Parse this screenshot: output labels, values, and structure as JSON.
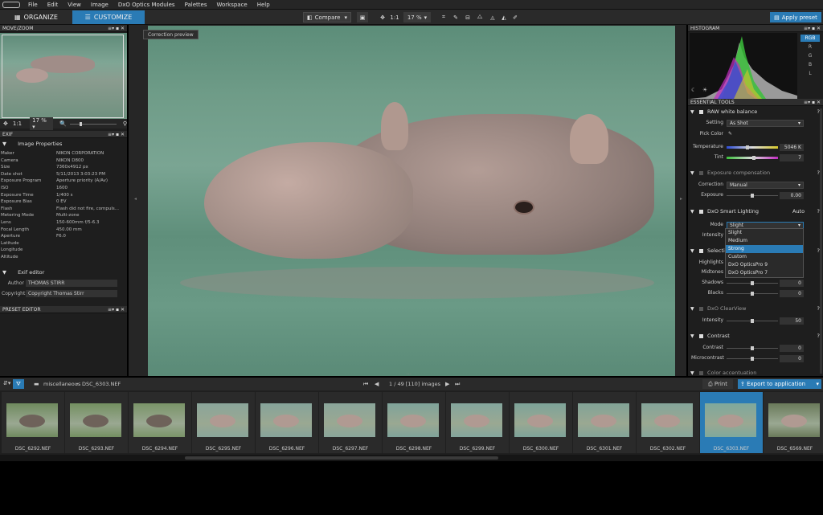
{
  "menu": [
    "File",
    "Edit",
    "View",
    "Image",
    "DxO Optics Modules",
    "Palettes",
    "Workspace",
    "Help"
  ],
  "toolbar": {
    "organize": "ORGANIZE",
    "customize": "CUSTOMIZE",
    "compare": "Compare",
    "zoom_ratio": "1:1",
    "zoom_pct": "17 %",
    "apply_preset": "Apply preset"
  },
  "left": {
    "movezoom_title": "MOVE/ZOOM",
    "zoom_ratio": "1:1",
    "zoom_pct": "17 %",
    "exif_title": "EXIF",
    "image_properties": "Image Properties",
    "exif": [
      {
        "k": "Maker",
        "v": "NIKON CORPORATION"
      },
      {
        "k": "Camera",
        "v": "NIKON D800"
      },
      {
        "k": "Size",
        "v": "7360x4912 px"
      },
      {
        "k": "Date shot",
        "v": "5/11/2013 3:03:23 PM"
      },
      {
        "k": "Exposure Program",
        "v": "Aperture priority (A/Av)"
      },
      {
        "k": "ISO",
        "v": "1600"
      },
      {
        "k": "Exposure Time",
        "v": "1/400 s"
      },
      {
        "k": "Exposure Bias",
        "v": "0 EV"
      },
      {
        "k": "Flash",
        "v": "Flash did not fire, compuls..."
      },
      {
        "k": "Metering Mode",
        "v": "Multi-zone"
      },
      {
        "k": "Lens",
        "v": "150-600mm f/5-6.3"
      },
      {
        "k": "Focal Length",
        "v": "450.00 mm"
      },
      {
        "k": "Aperture",
        "v": "F6.0"
      },
      {
        "k": "Latitude",
        "v": ""
      },
      {
        "k": "Longitude",
        "v": ""
      },
      {
        "k": "Altitude",
        "v": ""
      }
    ],
    "exif_editor": "Exif editor",
    "author_label": "Author",
    "author": "THOMAS STIRR",
    "copyright_label": "Copyright",
    "copyright": "Copyright Thomas Stirr",
    "preset_editor": "PRESET EDITOR"
  },
  "center": {
    "tooltip": "Correction preview"
  },
  "right": {
    "histogram_title": "HISTOGRAM",
    "channels": [
      "RGB",
      "R",
      "G",
      "B",
      "L"
    ],
    "essential_title": "ESSENTIAL TOOLS",
    "raw_wb": "RAW white balance",
    "setting_label": "Setting",
    "setting": "As Shot",
    "pick_color": "Pick Color",
    "temperature_label": "Temperature",
    "temperature": "5046 K",
    "tint_label": "Tint",
    "tint": "7",
    "exposure_comp": "Exposure compensation",
    "correction_label": "Correction",
    "correction": "Manual",
    "exposure_label": "Exposure",
    "exposure": "0.00",
    "smart_lighting": "DxO Smart Lighting",
    "smart_auto": "Auto",
    "mode_label": "Mode",
    "mode": "Slight",
    "intensity_label": "Intensity",
    "mode_options": [
      "Slight",
      "Medium",
      "Strong",
      "Custom",
      "DxO OpticsPro 9",
      "DxO OpticsPro 7"
    ],
    "selective": "Selecti",
    "highlights": "Highlights",
    "midtones": "Midtones",
    "shadows": "Shadows",
    "shadows_val": "0",
    "blacks": "Blacks",
    "blacks_val": "0",
    "clearview": "DxO ClearView",
    "cv_intensity_label": "Intensity",
    "cv_intensity": "50",
    "contrast_title": "Contrast",
    "contrast_label": "Contrast",
    "contrast": "0",
    "micro_label": "Microcontrast",
    "micro": "0",
    "color_accent": "Color accentuation"
  },
  "strip": {
    "path_folder": "miscellaneous",
    "path_file": "DSC_6303.NEF",
    "counter": "1 / 49 [110] images",
    "print": "Print",
    "export": "Export to application",
    "files": [
      "DSC_6292.NEF",
      "DSC_6293.NEF",
      "DSC_6294.NEF",
      "DSC_6295.NEF",
      "DSC_6296.NEF",
      "DSC_6297.NEF",
      "DSC_6298.NEF",
      "DSC_6299.NEF",
      "DSC_6300.NEF",
      "DSC_6301.NEF",
      "DSC_6302.NEF",
      "DSC_6303.NEF",
      "DSC_6569.NEF"
    ],
    "selected_index": 11
  }
}
